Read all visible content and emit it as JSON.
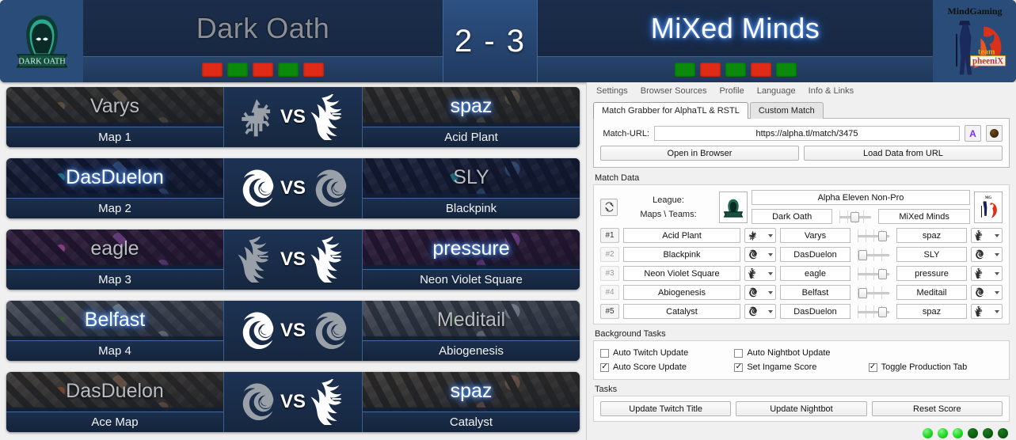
{
  "scoreboard": {
    "team1": {
      "name": "Dark Oath",
      "logo_name": "dark-oath-logo",
      "highlight": false
    },
    "team2": {
      "name": "MiXed Minds",
      "logo_name": "mind-gaming-logo",
      "highlight": true
    },
    "score": "2 - 3",
    "team1_pips": [
      "loss",
      "win",
      "loss",
      "win",
      "loss"
    ],
    "team2_pips": [
      "win",
      "loss",
      "win",
      "loss",
      "win"
    ],
    "colors": {
      "win": "#0b8a0b",
      "loss": "#e02b16",
      "panel": "#26456e",
      "glow": "#6fa8ff"
    }
  },
  "maps": [
    {
      "label": "Map 1",
      "map_name": "Acid Plant",
      "player1": "Varys",
      "player1_race": "terran",
      "player1_lit": false,
      "player2": "spaz",
      "player2_race": "protoss",
      "player2_lit": true
    },
    {
      "label": "Map 2",
      "map_name": "Blackpink",
      "player1": "DasDuelon",
      "player1_race": "zerg",
      "player1_lit": true,
      "player2": "SLY",
      "player2_race": "zerg",
      "player2_lit": false
    },
    {
      "label": "Map 3",
      "map_name": "Neon Violet Square",
      "player1": "eagle",
      "player1_race": "protoss",
      "player1_lit": false,
      "player2": "pressure",
      "player2_race": "protoss",
      "player2_lit": true
    },
    {
      "label": "Map 4",
      "map_name": "Abiogenesis",
      "player1": "Belfast",
      "player1_race": "zerg",
      "player1_lit": true,
      "player2": "Meditail",
      "player2_race": "zerg",
      "player2_lit": false
    },
    {
      "label": "Ace Map",
      "map_name": "Catalyst",
      "player1": "DasDuelon",
      "player1_race": "zerg",
      "player1_lit": false,
      "player2": "spaz",
      "player2_race": "protoss",
      "player2_lit": true
    }
  ],
  "vs_text": "VS",
  "app": {
    "menu": [
      "Settings",
      "Browser Sources",
      "Profile",
      "Language",
      "Info & Links"
    ],
    "tabs": [
      {
        "label": "Match Grabber for AlphaTL & RSTL",
        "active": true
      },
      {
        "label": "Custom Match",
        "active": false
      }
    ],
    "match_url": {
      "label": "Match-URL:",
      "value": "https://alpha.tl/match/3475",
      "placeholder": "https://alpha.tl/match/",
      "icon_alpha": "A",
      "icon_rstl": "rstl-icon"
    },
    "url_buttons": [
      "Open in Browser",
      "Load Data from URL"
    ],
    "match_data": {
      "group_label": "Match Data",
      "refresh_icon": "refresh-icon",
      "labels": {
        "league": "League:",
        "maps_teams": "Maps \\ Teams:"
      },
      "league": "Alpha Eleven Non-Pro",
      "team1": "Dark Oath",
      "team2": "MiXed Minds",
      "team1_logo": "dark-oath-logo",
      "team2_logo": "mind-gaming-logo",
      "score_slider": "center",
      "rows": [
        {
          "num": "#1",
          "num_active": true,
          "map": "Acid Plant",
          "p1": "Varys",
          "r1": "terran",
          "p2": "spaz",
          "r2": "protoss",
          "slider": "right"
        },
        {
          "num": "#2",
          "num_active": false,
          "map": "Blackpink",
          "p1": "DasDuelon",
          "r1": "zerg",
          "p2": "SLY",
          "r2": "zerg",
          "slider": "left"
        },
        {
          "num": "#3",
          "num_active": false,
          "map": "Neon Violet Square",
          "p1": "eagle",
          "r1": "protoss",
          "p2": "pressure",
          "r2": "protoss",
          "slider": "right"
        },
        {
          "num": "#4",
          "num_active": false,
          "map": "Abiogenesis",
          "p1": "Belfast",
          "r1": "zerg",
          "p2": "Meditail",
          "r2": "zerg",
          "slider": "left"
        },
        {
          "num": "#5",
          "num_active": true,
          "map": "Catalyst",
          "p1": "DasDuelon",
          "r1": "zerg",
          "p2": "spaz",
          "r2": "protoss",
          "slider": "right"
        }
      ]
    },
    "background_tasks": {
      "group_label": "Background Tasks",
      "items": [
        {
          "label": "Auto Twitch Update",
          "checked": false
        },
        {
          "label": "Auto Nightbot Update",
          "checked": false
        },
        {
          "label": "",
          "checked": null
        },
        {
          "label": "Auto Score Update",
          "checked": true
        },
        {
          "label": "Set Ingame Score",
          "checked": true
        },
        {
          "label": "Toggle Production Tab",
          "checked": true
        }
      ]
    },
    "tasks": {
      "group_label": "Tasks",
      "buttons": [
        "Update Twitch Title",
        "Update Nightbot",
        "Reset Score"
      ],
      "status_dots": [
        "on",
        "on",
        "on",
        "off",
        "off",
        "off"
      ],
      "dot_colors": {
        "on": "#1fd41f",
        "off": "#0d5c10"
      }
    }
  }
}
